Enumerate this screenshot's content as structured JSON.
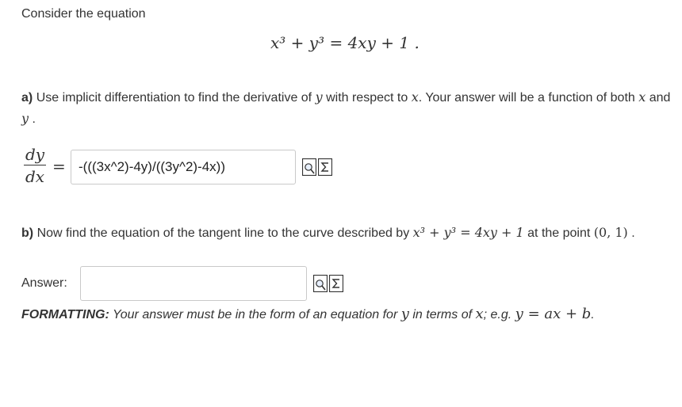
{
  "intro": "Consider the equation",
  "equation": {
    "lhs": "x³ + y³",
    "rhs": "4xy + 1",
    "period": "."
  },
  "part_a": {
    "label": "a)",
    "text_1": "Use implicit differentiation to find the derivative of",
    "var_y": "y",
    "text_2": "with respect to",
    "var_x": "x",
    "text_3": ". Your answer will be a function of both",
    "text_4": "and",
    "text_5": ".",
    "deriv_num": "dy",
    "deriv_den": "dx",
    "equals": "=",
    "answer_value": "-(((3x^2)-4y)/((3y^2)-4x))"
  },
  "part_b": {
    "label": "b)",
    "text_1": "Now find the equation of the tangent line to the curve described by",
    "curve": "x³ + y³ = 4xy + 1",
    "text_2": "at the point",
    "point": "(0, 1)",
    "text_3": ".",
    "answer_label": "Answer:",
    "answer_value": ""
  },
  "formatting": {
    "label": "FORMATTING:",
    "text": "Your answer must be in the form of an equation for",
    "var_y": "y",
    "text_2": "in terms of",
    "var_x": "x",
    "text_3": "; e.g.",
    "example": "y = ax + b",
    "end": "."
  }
}
